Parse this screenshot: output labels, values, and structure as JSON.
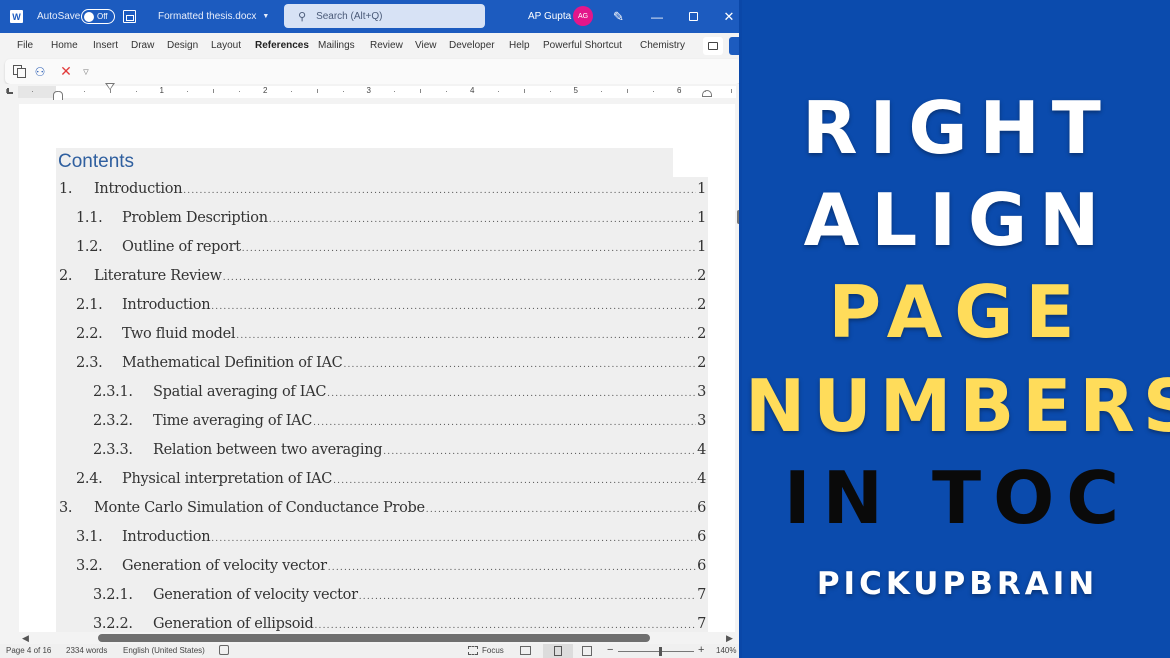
{
  "titlebar": {
    "autosave_label": "AutoSave",
    "autosave_state": "Off",
    "document_title": "Formatted thesis.docx",
    "search_placeholder": "Search (Alt+Q)",
    "user_name": "AP Gupta",
    "user_initials": "AG"
  },
  "menu": {
    "tabs": [
      {
        "label": "File"
      },
      {
        "label": "Home"
      },
      {
        "label": "Insert"
      },
      {
        "label": "Draw"
      },
      {
        "label": "Design"
      },
      {
        "label": "Layout"
      },
      {
        "label": "References",
        "active": true
      },
      {
        "label": "Mailings"
      },
      {
        "label": "Review"
      },
      {
        "label": "View"
      },
      {
        "label": "Developer"
      },
      {
        "label": "Help"
      },
      {
        "label": "Powerful Shortcut"
      },
      {
        "label": "Chemistry"
      }
    ]
  },
  "ribbon": {
    "icons": [
      "add-text-icon",
      "hierarchy-icon",
      "delete-toc-icon",
      "customize-qat-icon"
    ]
  },
  "ruler": {
    "numbers": [
      "1",
      "2",
      "3",
      "4",
      "5",
      "6"
    ]
  },
  "toc": {
    "title": "Contents",
    "leader": "........................................................................................................................................................................................................",
    "entries": [
      {
        "level": 1,
        "number": "1.",
        "text": "Introduction",
        "page": "1"
      },
      {
        "level": 2,
        "number": "1.1.",
        "text": "Problem Description",
        "page": "1"
      },
      {
        "level": 2,
        "number": "1.2.",
        "text": "Outline of report",
        "page": "1"
      },
      {
        "level": 1,
        "number": "2.",
        "text": "Literature Review ",
        "page": "2"
      },
      {
        "level": 2,
        "number": "2.1.",
        "text": "Introduction ",
        "page": "2"
      },
      {
        "level": 2,
        "number": "2.2.",
        "text": "Two fluid model",
        "page": "2"
      },
      {
        "level": 2,
        "number": "2.3.",
        "text": "Mathematical Definition of IAC",
        "page": "2"
      },
      {
        "level": 3,
        "number": "2.3.1.",
        "text": "Spatial averaging of IAC",
        "page": "3"
      },
      {
        "level": 3,
        "number": "2.3.2.",
        "text": "Time averaging of IAC",
        "page": "3"
      },
      {
        "level": 3,
        "number": "2.3.3.",
        "text": "Relation between two averaging",
        "page": "4"
      },
      {
        "level": 2,
        "number": "2.4.",
        "text": "Physical interpretation of IAC ",
        "page": "4"
      },
      {
        "level": 1,
        "number": "3.",
        "text": "Monte Carlo Simulation of Conductance Probe ",
        "page": "6"
      },
      {
        "level": 2,
        "number": "3.1.",
        "text": "Introduction ",
        "page": "6"
      },
      {
        "level": 2,
        "number": "3.2.",
        "text": "Generation of velocity vector",
        "page": "6"
      },
      {
        "level": 3,
        "number": "3.2.1.",
        "text": "Generation of velocity vector",
        "page": "7"
      },
      {
        "level": 3,
        "number": "3.2.2.",
        "text": "Generation of ellipsoid",
        "page": "7"
      }
    ]
  },
  "statusbar": {
    "page": "Page 4 of 16",
    "words": "2334 words",
    "language": "English (United States)",
    "focus_label": "Focus",
    "zoom_minus": "−",
    "zoom_plus": "+",
    "zoom_level": "140%",
    "zoom_percent": 140
  },
  "banner": {
    "line1": "RIGHT",
    "line2": "ALIGN",
    "line3": "PAGE",
    "line4": "NUMBERS",
    "line5": "IN TOC",
    "brand": "PICKUPBRAIN",
    "colors": {
      "background": "#0b4bad",
      "white": "#ffffff",
      "yellow": "#ffdc5a",
      "black": "#0a0a0a"
    }
  }
}
